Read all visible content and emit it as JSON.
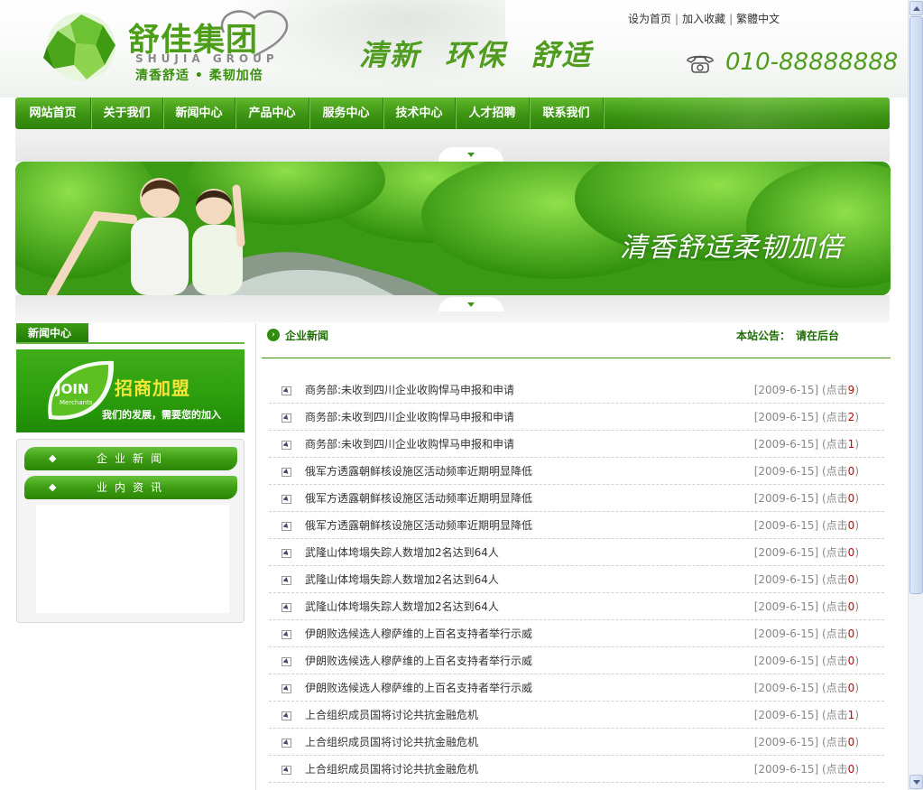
{
  "header": {
    "logo_cn": "舒佳集团",
    "logo_en": "SHUJIA GROUP",
    "logo_slogan": "清香舒适 • 柔韧加倍",
    "slogan": "清新 环保 舒适",
    "top_links": [
      "设为首页",
      "加入收藏",
      "繁體中文"
    ],
    "phone": "010-88888888"
  },
  "nav": {
    "items": [
      "网站首页",
      "关于我们",
      "新闻中心",
      "产品中心",
      "服务中心",
      "技术中心",
      "人才招聘",
      "联系我们"
    ]
  },
  "banner": {
    "text": "清香舒适柔韧加倍"
  },
  "sidebar": {
    "tab_title": "新闻中心",
    "join_logo": "JOIN",
    "join_logo_sub": "Merchants",
    "join_title": "招商加盟",
    "join_sub": "我们的发展，需要您的加入",
    "menu": [
      {
        "bullet": "◆",
        "label": "企业新闻"
      },
      {
        "bullet": "◆",
        "label": "业内资讯"
      }
    ]
  },
  "news": {
    "section_title": "企业新闻",
    "notice_label": "本站公告：",
    "notice_text": "请在后台",
    "items": [
      {
        "title": "商务部:未收到四川企业收购悍马申报和申请",
        "date": "[2009-6-15]",
        "hits_prefix": "(点击",
        "hits": "9",
        "hits_suffix": ")"
      },
      {
        "title": "商务部:未收到四川企业收购悍马申报和申请",
        "date": "[2009-6-15]",
        "hits_prefix": "(点击",
        "hits": "2",
        "hits_suffix": ")"
      },
      {
        "title": "商务部:未收到四川企业收购悍马申报和申请",
        "date": "[2009-6-15]",
        "hits_prefix": "(点击",
        "hits": "1",
        "hits_suffix": ")"
      },
      {
        "title": "俄军方透露朝鲜核设施区活动频率近期明显降低",
        "date": "[2009-6-15]",
        "hits_prefix": "(点击",
        "hits": "0",
        "hits_suffix": ")"
      },
      {
        "title": "俄军方透露朝鲜核设施区活动频率近期明显降低",
        "date": "[2009-6-15]",
        "hits_prefix": "(点击",
        "hits": "0",
        "hits_suffix": ")"
      },
      {
        "title": "俄军方透露朝鲜核设施区活动频率近期明显降低",
        "date": "[2009-6-15]",
        "hits_prefix": "(点击",
        "hits": "0",
        "hits_suffix": ")"
      },
      {
        "title": "武隆山体垮塌失踪人数增加2名达到64人",
        "date": "[2009-6-15]",
        "hits_prefix": "(点击",
        "hits": "0",
        "hits_suffix": ")"
      },
      {
        "title": "武隆山体垮塌失踪人数增加2名达到64人",
        "date": "[2009-6-15]",
        "hits_prefix": "(点击",
        "hits": "0",
        "hits_suffix": ")"
      },
      {
        "title": "武隆山体垮塌失踪人数增加2名达到64人",
        "date": "[2009-6-15]",
        "hits_prefix": "(点击",
        "hits": "0",
        "hits_suffix": ")"
      },
      {
        "title": "伊朗败选候选人穆萨维的上百名支持者举行示威",
        "date": "[2009-6-15]",
        "hits_prefix": "(点击",
        "hits": "0",
        "hits_suffix": ")"
      },
      {
        "title": "伊朗败选候选人穆萨维的上百名支持者举行示威",
        "date": "[2009-6-15]",
        "hits_prefix": "(点击",
        "hits": "0",
        "hits_suffix": ")"
      },
      {
        "title": "伊朗败选候选人穆萨维的上百名支持者举行示威",
        "date": "[2009-6-15]",
        "hits_prefix": "(点击",
        "hits": "0",
        "hits_suffix": ")"
      },
      {
        "title": "上合组织成员国将讨论共抗金融危机",
        "date": "[2009-6-15]",
        "hits_prefix": "(点击",
        "hits": "1",
        "hits_suffix": ")"
      },
      {
        "title": "上合组织成员国将讨论共抗金融危机",
        "date": "[2009-6-15]",
        "hits_prefix": "(点击",
        "hits": "0",
        "hits_suffix": ")"
      },
      {
        "title": "上合组织成员国将讨论共抗金融危机",
        "date": "[2009-6-15]",
        "hits_prefix": "(点击",
        "hits": "0",
        "hits_suffix": ")"
      }
    ]
  },
  "icons": {
    "logo_mark": "logo-mark-icon",
    "phone": "telephone-icon",
    "news_head": "circle-arrow-icon",
    "news_bullet": "arrow-box-icon",
    "join_leaf": "leaf-icon"
  },
  "colors": {
    "brand_green": "#3d9414",
    "nav_green": "#4fa81f",
    "headline_green": "#1d6d04",
    "hits_red": "#cc0000",
    "join_yellow": "#f2e63a"
  }
}
